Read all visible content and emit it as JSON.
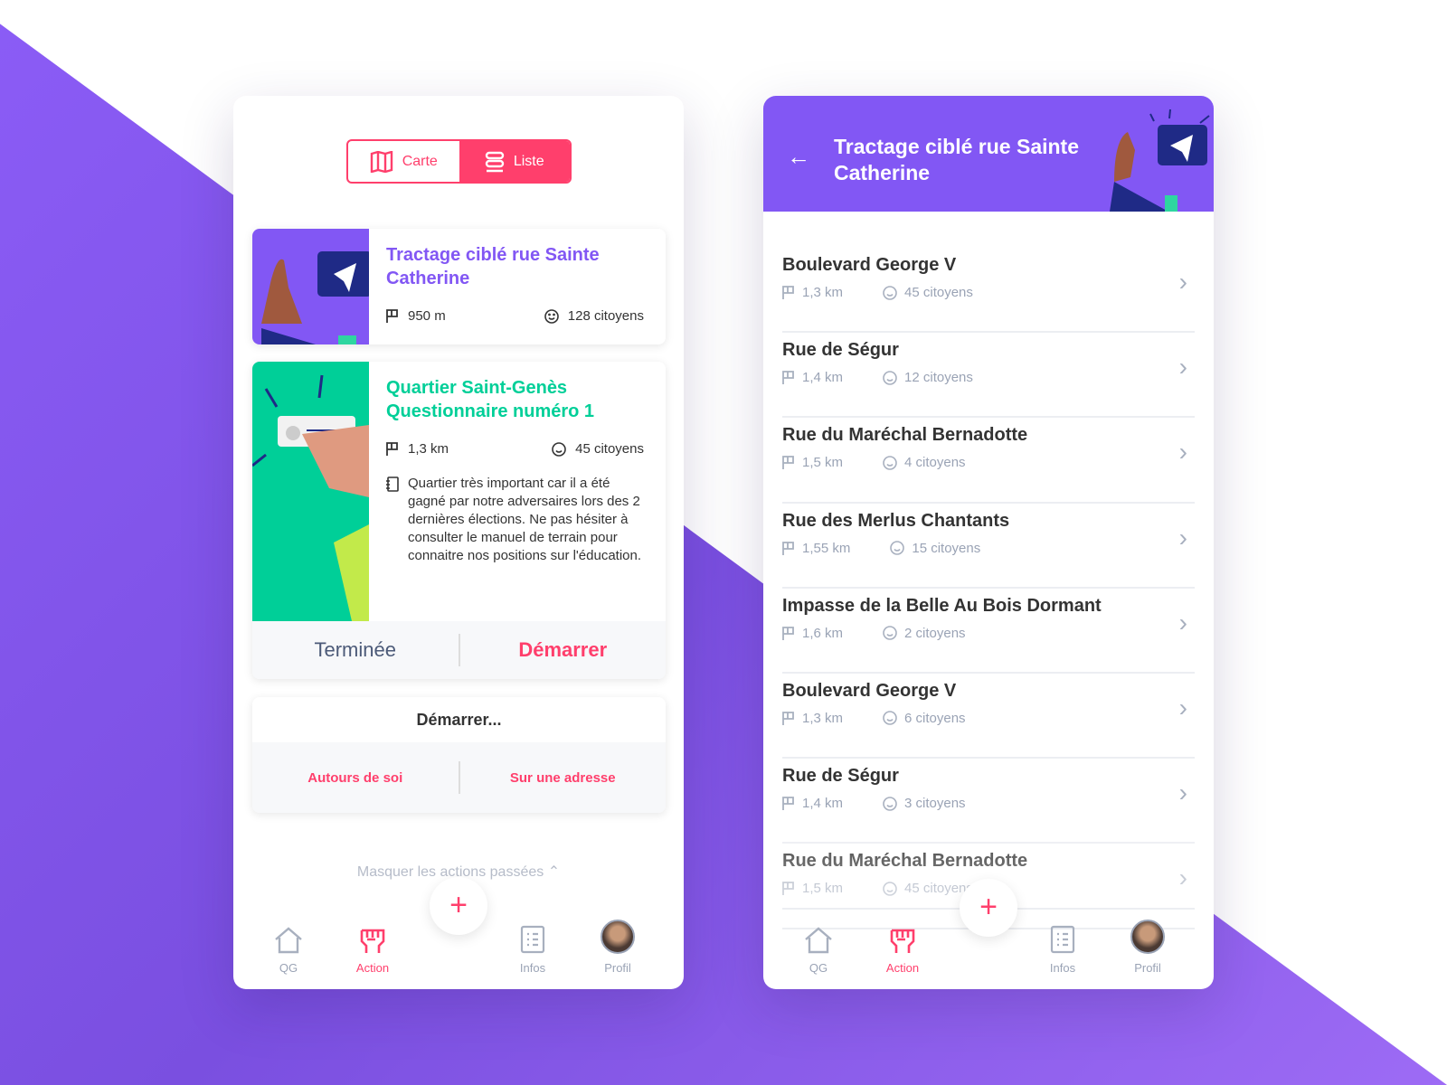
{
  "colors": {
    "accent": "#ff3f6c",
    "purple": "#8257f4",
    "green": "#00cf98"
  },
  "left": {
    "toggle": {
      "carte": "Carte",
      "liste": "Liste",
      "active": "liste"
    },
    "cards": [
      {
        "title": "Tractage ciblé rue Sainte Catherine",
        "distance": "950 m",
        "citizens": "128 citoyens"
      },
      {
        "title": "Quartier Saint-Genès Questionnaire numéro 1",
        "distance": "1,3 km",
        "citizens": "45 citoyens",
        "description": "Quartier très important car il a été gagné par notre adversaires lors des 2 dernières élections. Ne pas hésiter à consulter le manuel de terrain pour connaitre nos positions sur l'éducation.",
        "done": "Terminée",
        "start": "Démarrer"
      }
    ],
    "start_card": {
      "title": "Démarrer...",
      "around": "Autours de soi",
      "address": "Sur une adresse"
    },
    "hide_past": "Masquer les actions passées"
  },
  "right": {
    "title": "Tractage ciblé rue Sainte Catherine",
    "items": [
      {
        "name": "Boulevard George V",
        "distance": "1,3 km",
        "citizens": "45 citoyens"
      },
      {
        "name": "Rue de Ségur",
        "distance": "1,4 km",
        "citizens": "12 citoyens"
      },
      {
        "name": "Rue du Maréchal Bernadotte",
        "distance": "1,5 km",
        "citizens": "4 citoyens"
      },
      {
        "name": "Rue des Merlus Chantants",
        "distance": "1,55 km",
        "citizens": "15 citoyens"
      },
      {
        "name": "Impasse de la Belle Au Bois Dormant",
        "distance": "1,6 km",
        "citizens": "2 citoyens"
      },
      {
        "name": "Boulevard George V",
        "distance": "1,3 km",
        "citizens": "6 citoyens"
      },
      {
        "name": "Rue de Ségur",
        "distance": "1,4 km",
        "citizens": "3 citoyens"
      },
      {
        "name": "Rue du Maréchal Bernadotte",
        "distance": "1,5 km",
        "citizens": "45 citoyens"
      }
    ]
  },
  "tabbar": {
    "qg": "QG",
    "action": "Action",
    "plus": "+",
    "infos": "Infos",
    "profil": "Profil",
    "active": "action"
  }
}
